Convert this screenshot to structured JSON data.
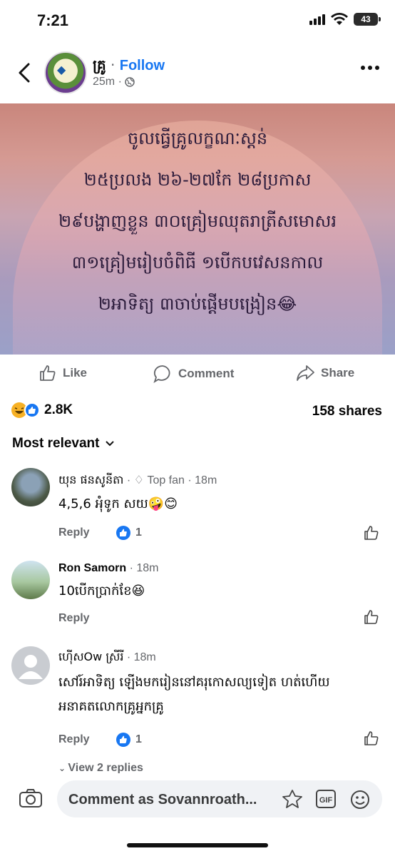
{
  "status_bar": {
    "time": "7:21",
    "battery": "43"
  },
  "header": {
    "page_name": "គ្រូ",
    "separator": " · ",
    "follow_label": "Follow",
    "time_ago": "25m ·"
  },
  "post": {
    "lines": [
      "ចូលធ្វើគ្រូលក្ខណៈស្តន់",
      "២៥ប្រលង ២៦-២៧កែ ២៨ប្រកាស",
      "២៩បង្ហាញខ្លួន ៣០គ្រៀមឈុតរាត្រីសមោសរ",
      "៣១គ្រៀមរៀបចំពិធី ១បើកបវេសនកាល",
      "២អាទិត្យ ៣ចាប់ផ្តើមបង្រៀន😂"
    ]
  },
  "actions": {
    "like": "Like",
    "comment": "Comment",
    "share": "Share"
  },
  "stats": {
    "reactions": "2.8K",
    "shares": "158 shares"
  },
  "sort": {
    "label": "Most relevant"
  },
  "comments": [
    {
      "name": "យុន ផនសូនីតា",
      "badge": "Top fan",
      "time": "18m",
      "text": "4,5,6 អុំទូក សយ🤪😊",
      "reply": "Reply",
      "likes": "1"
    },
    {
      "name": "Ron Samorn",
      "time": "18m",
      "text": "10បើកប្រាក់ខែ😆",
      "reply": "Reply"
    },
    {
      "name": "ហ៊ើសOw ស្រីរី",
      "time": "18m",
      "text_line1": "សៅរ៍អាទិត្យ ឡើងមករៀននៅគរុកោសល្យទៀត ហត់ហើយ",
      "text_line2": "អនាគតលោកគ្រូអ្នកគ្រូ",
      "reply": "Reply",
      "likes": "1"
    }
  ],
  "view_replies": "View 2 replies",
  "composer": {
    "placeholder": "Comment as Sovannroath..."
  },
  "colors": {
    "accent": "#1877f2",
    "muted": "#65676b"
  }
}
